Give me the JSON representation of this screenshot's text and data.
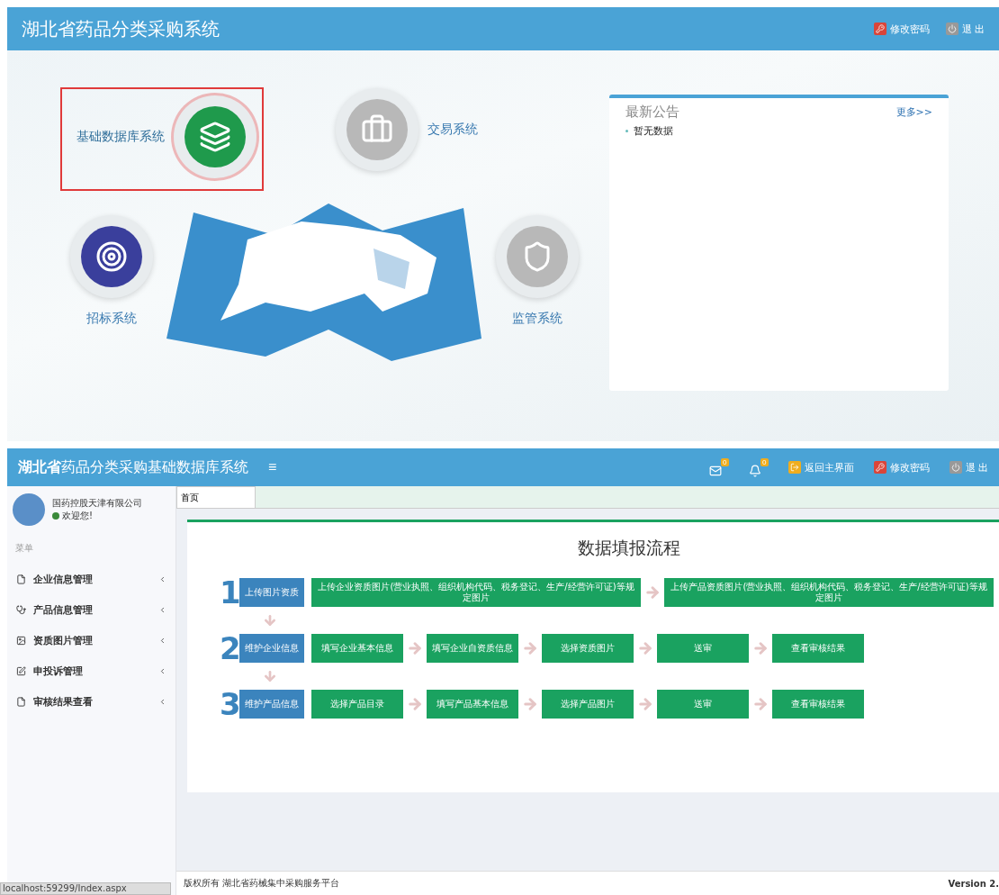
{
  "portal": {
    "title": "湖北省药品分类采购系统",
    "actions": [
      {
        "kind": "password",
        "label": "修改密码"
      },
      {
        "kind": "logout",
        "label": "退 出"
      }
    ],
    "systems": [
      {
        "kind": "database",
        "label": "基础数据库系统",
        "selected": true
      },
      {
        "kind": "trade",
        "label": "交易系统",
        "selected": false
      },
      {
        "kind": "tender",
        "label": "招标系统",
        "selected": false
      },
      {
        "kind": "supervise",
        "label": "监管系统",
        "selected": false
      }
    ],
    "notice": {
      "title": "最新公告",
      "more": "更多>>",
      "items": [
        "暂无数据"
      ]
    }
  },
  "app": {
    "title_bold": "湖北省",
    "title": "药品分类采购基础数据库系统",
    "menu_glyph": "≡",
    "actions": [
      {
        "kind": "mail",
        "badge": "0"
      },
      {
        "kind": "bell",
        "badge": "0"
      },
      {
        "kind": "home",
        "label": "返回主界面"
      },
      {
        "kind": "password",
        "label": "修改密码"
      },
      {
        "kind": "logout",
        "label": "退 出"
      }
    ],
    "user": {
      "name": "国药控股天津有限公司",
      "status": "欢迎您!"
    },
    "menu_label": "菜单",
    "menu": [
      {
        "kind": "file",
        "label": "企业信息管理"
      },
      {
        "kind": "stethoscope",
        "label": "产品信息管理"
      },
      {
        "kind": "image",
        "label": "资质图片管理"
      },
      {
        "kind": "edit",
        "label": "申投诉管理"
      },
      {
        "kind": "file",
        "label": "审核结果查看"
      }
    ],
    "tabs": [
      {
        "label": "首页",
        "selected": true
      }
    ],
    "flow": {
      "title": "数据填报流程",
      "rows": [
        {
          "number": "1",
          "label": "上传图片资质",
          "steps": [
            "上传企业资质图片(营业执照、组织机构代码、税务登记、生产/经营许可证)等规定图片",
            "上传产品资质图片(营业执照、组织机构代码、税务登记、生产/经营许可证)等规定图片"
          ]
        },
        {
          "number": "2",
          "label": "维护企业信息",
          "steps": [
            "填写企业基本信息",
            "填写企业自资质信息",
            "选择资质图片",
            "送审",
            "查看审核结果"
          ]
        },
        {
          "number": "3",
          "label": "维护产品信息",
          "steps": [
            "选择产品目录",
            "填写产品基本信息",
            "选择产品图片",
            "送审",
            "查看审核结果"
          ]
        }
      ]
    },
    "footer": {
      "copyright": "版权所有 湖北省药械集中采购服务平台",
      "version": "Version 2."
    },
    "status_url": "localhost:59299/Index.aspx"
  }
}
